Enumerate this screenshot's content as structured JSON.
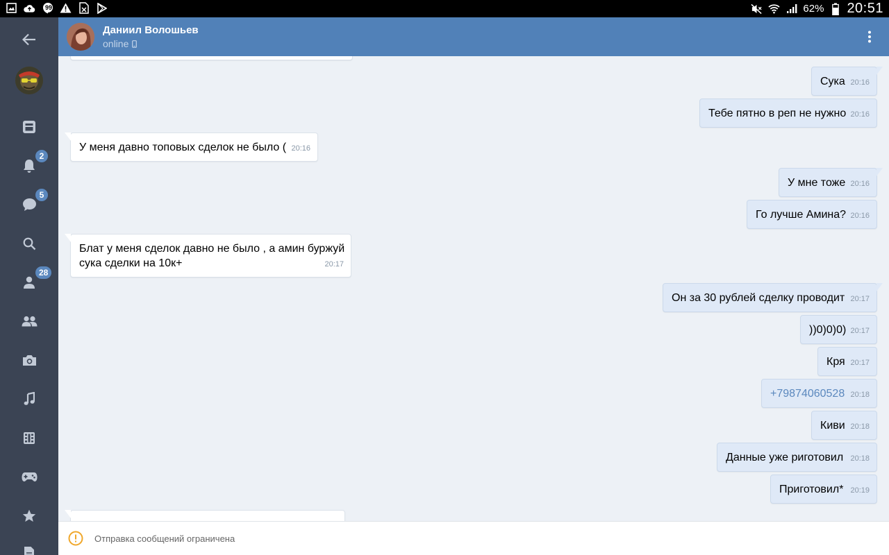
{
  "statusbar": {
    "battery": "62%",
    "clock": "20:51"
  },
  "rail": {
    "badges": {
      "notifications": "2",
      "messages": "5",
      "friends": "28"
    }
  },
  "header": {
    "name": "Даниил Волошьев",
    "status": "online"
  },
  "messages": [
    {
      "dir": "out",
      "text": "Сука",
      "time": "20:16"
    },
    {
      "dir": "out",
      "text": "Тебе пятно в реп не нужно",
      "time": "20:16"
    },
    {
      "dir": "in",
      "text": "У меня давно топовых сделок не было (",
      "time": "20:16"
    },
    {
      "dir": "out",
      "text": "У мне тоже",
      "time": "20:16"
    },
    {
      "dir": "out",
      "text": "Го лучше Амина?",
      "time": "20:16"
    },
    {
      "dir": "in",
      "text": "Блат у меня сделок давно не было , а амин буржуй сука сделки на 10к+",
      "time": "20:17"
    },
    {
      "dir": "out",
      "text": "Он за 30 рублей сделку проводит",
      "time": "20:17"
    },
    {
      "dir": "out",
      "text": "))0)0)0)",
      "time": "20:17"
    },
    {
      "dir": "out",
      "text": "Кря",
      "time": "20:17"
    },
    {
      "dir": "out",
      "text": "+79874060528",
      "time": "20:18"
    },
    {
      "dir": "out",
      "text": "Киви",
      "time": "20:18"
    },
    {
      "dir": "out",
      "text": "Данные уже риготовил",
      "time": "20:18"
    },
    {
      "dir": "out",
      "text": "Приготовил*",
      "time": "20:19"
    }
  ],
  "bottombar": {
    "notice": "Отправка сообщений ограничена"
  },
  "colors": {
    "header": "#5181b8",
    "rail": "#3b4454",
    "badge": "#5b88be",
    "bubble_out": "#dfe9f7",
    "chat_bg": "#edf1f6",
    "warning": "#f0a72a"
  }
}
